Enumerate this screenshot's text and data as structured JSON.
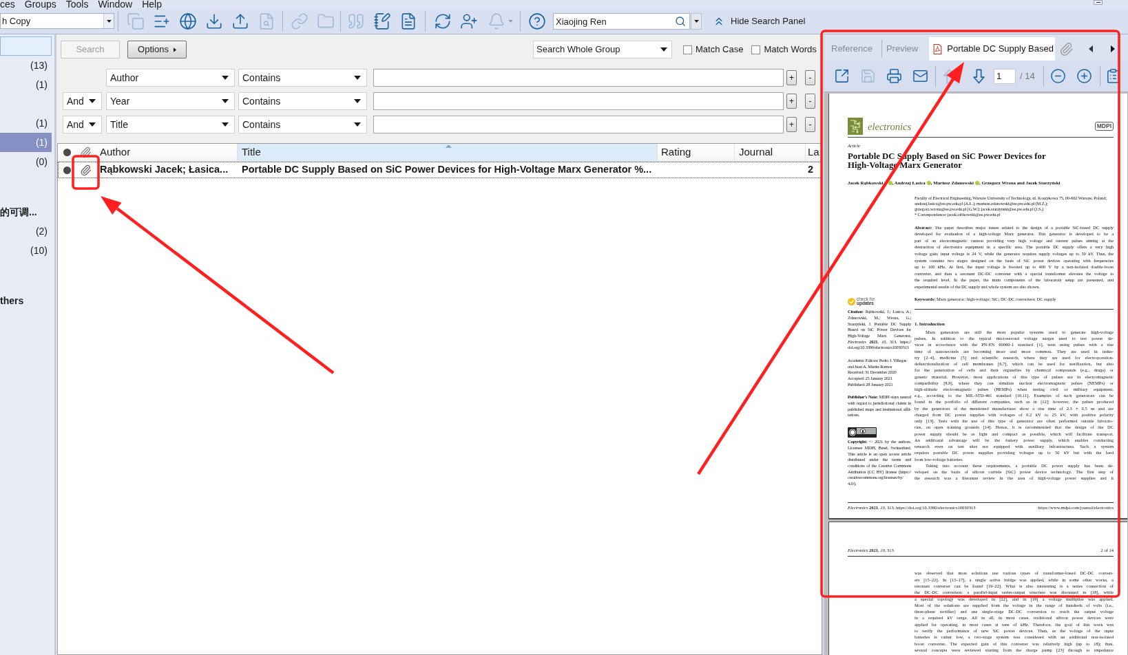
{
  "menu": [
    {
      "label": "ces"
    },
    {
      "label": "Groups"
    },
    {
      "label": "Tools"
    },
    {
      "label": "Window"
    },
    {
      "label": "Help"
    }
  ],
  "toolbar": {
    "style_dropdown": "h Copy",
    "groups": [
      [
        {
          "kind": "copy",
          "disabled": true
        },
        {
          "kind": "new-reference",
          "disabled": false
        },
        {
          "kind": "online-search",
          "disabled": false
        },
        {
          "kind": "import",
          "disabled": false
        },
        {
          "kind": "export",
          "disabled": false
        },
        {
          "kind": "find-pdf",
          "disabled": true
        }
      ],
      [
        {
          "kind": "link",
          "disabled": true
        },
        {
          "kind": "folder",
          "disabled": true
        }
      ],
      [
        {
          "kind": "citation",
          "disabled": true
        },
        {
          "kind": "edit",
          "disabled": false
        },
        {
          "kind": "word",
          "disabled": false
        }
      ],
      [
        {
          "kind": "sync",
          "disabled": false
        },
        {
          "kind": "share",
          "disabled": false
        },
        {
          "kind": "notify",
          "disabled": true
        }
      ],
      [
        {
          "kind": "help",
          "disabled": false
        }
      ]
    ],
    "search": {
      "value": "Xiaojing Ren"
    },
    "hide_panel": "Hide Search Panel"
  },
  "sidebar": {
    "items": [
      {
        "kind": "group",
        "focused": true,
        "selected": false
      },
      {
        "kind": "group",
        "count": "(13)",
        "focused": false,
        "selected": false
      },
      {
        "kind": "group",
        "count": "(1)",
        "focused": false,
        "selected": false
      },
      {
        "kind": "group",
        "focused": false,
        "selected": false
      },
      {
        "kind": "group",
        "count": "(1)",
        "focused": false,
        "selected": false
      },
      {
        "kind": "group",
        "count": "(1)",
        "focused": false,
        "selected": true
      },
      {
        "kind": "group",
        "count": "(0)",
        "focused": false,
        "selected": false
      },
      {
        "kind": "set",
        "label": "的可调..."
      },
      {
        "kind": "group",
        "count": "(2)",
        "focused": false,
        "selected": false
      },
      {
        "kind": "group",
        "count": "(10)",
        "focused": false,
        "selected": false
      },
      {
        "kind": "set",
        "label": "thers"
      }
    ]
  },
  "search_panel": {
    "search_button": {
      "label": "Search",
      "disabled": true
    },
    "options_button": {
      "label": "Options"
    },
    "scope": {
      "value": "Search Whole Group"
    },
    "checkboxes": [
      {
        "label": "Match Case",
        "checked": false
      },
      {
        "label": "Match Words",
        "checked": false
      }
    ],
    "rows": [
      {
        "field": "Author",
        "operator": "Contains",
        "add": "+",
        "remove": "-"
      },
      {
        "connector": "And",
        "field": "Year",
        "operator": "Contains",
        "add": "+",
        "remove": "-"
      },
      {
        "connector": "And",
        "field": "Title",
        "operator": "Contains",
        "add": "+",
        "remove": "-"
      }
    ]
  },
  "references": {
    "columns": [
      {
        "label": "Author",
        "sorted": false
      },
      {
        "label": "Title",
        "sorted": true
      },
      {
        "label": "Rating",
        "sorted": false
      },
      {
        "label": "Journal",
        "sorted": false
      },
      {
        "label": "La",
        "sorted": false
      }
    ],
    "rows": [
      {
        "unread": true,
        "attachment": true,
        "focused": true,
        "author": "Rąbkowski Jacek; Łasica...",
        "title": "Portable DC Supply Based on SiC Power Devices for High-Voltage Marx Generator %...",
        "column_5": "2"
      }
    ]
  },
  "pdf_viewer": {
    "tabs": [
      {
        "label": "Reference",
        "kind": "text",
        "selected": false
      },
      {
        "label": "Preview",
        "kind": "text",
        "selected": false
      },
      {
        "label": "Portable DC Supply Based",
        "kind": "file",
        "selected": true
      }
    ],
    "file_buttons": [
      {
        "kind": "open",
        "disabled": false
      },
      {
        "kind": "save",
        "disabled": true
      },
      {
        "kind": "print",
        "disabled": false
      },
      {
        "kind": "email",
        "disabled": false
      }
    ],
    "nav_buttons": [
      {
        "kind": "up",
        "disabled": true
      },
      {
        "kind": "down",
        "disabled": false
      }
    ],
    "page": "1",
    "total": "/ 14",
    "zoom_buttons": [
      {
        "kind": "zoom-out",
        "disabled": false
      },
      {
        "kind": "zoom-in",
        "disabled": false
      }
    ],
    "extra_buttons": [
      {
        "kind": "clipboard",
        "disabled": false
      }
    ],
    "pages": [
      {
        "kind": "first",
        "journal": "electronics",
        "publisher": "MDPI",
        "article_type": "Article",
        "title_lines": [
          "Portable DC Supply Based on SiC Power Devices for",
          "High-Voltage Marx Generator"
        ],
        "authors": [
          {
            "text": "Jacek Rąbkowski *",
            "id_icon": true
          },
          {
            "text": ", Andrzej Łasica",
            "id_icon": true
          },
          {
            "text": ", Mariusz Zdanowski",
            "id_icon": true
          },
          {
            "text": ", Grzegorz Wrona and Jacek Starzyński",
            "id_icon": false
          }
        ],
        "affiliation": [
          "Faculty of Electrical Engineering, Warsaw University of Technology, ul. Koszykowa 75, 00-662 Warsaw, Poland;",
          "andrzej.lasica@ee.pw.edu.pl (A.Ł.); mariusz.zdanowski@ee.pw.edu.pl (M.Z.);",
          "grzegorz.wrona@ee.pw.edu.pl (G.W.); jacek.starzynski@ee.pw.edu.pl (J.S.)",
          "* Correspondence: jacek.rabkowski@ee.pw.edu.pl"
        ],
        "abstract": [
          "**Abstract:** The paper describes major issues related to the design of a portable SiC-based DC supply",
          "developed for evaluation of a high-voltage Marx generator. This generator is developed to be a",
          "part of an electromagnetic cannon providing very high voltage and current pulses aiming at the",
          "destruction of electronics equipment in a specific area. The portable DC supply offers a very high",
          "voltage gain: input voltage is 24 V, while the generator requires supply voltages up to 50 kV. Thus, the",
          "system contains two stages designed on the basis of SiC power devices operating with frequencies",
          "up to 100 kHz. At first, the input voltage is boosted up to 400 V by a non-isolated double-boost",
          "converter, and then a resonant DC-DC converter with a special transformer elevates the voltage to",
          "the required level. In the paper, the main components of the laboratory setup are presented, and",
          "experimental results of the DC supply and whole system are also shown."
        ],
        "keywords": "**Keywords:** Marx generator; high-voltage; SiC; DC-DC converters; DC supply",
        "badge_lines": [
          "check for",
          "updates"
        ],
        "side_notes": [
          {
            "kind": "note",
            "lines": [
              "**Citation:** Rąbkowski, J.; Łasica, A.;",
              "Zdanowski, M.; Wrona, G.;",
              "Starzyński, J. Portable DC Supply",
              "Based on SiC Power Devices for",
              "High-Voltage Marx Generator.",
              "*Electronics* **2021**, *10*, 313. https://",
              "doi.org/10.3390/electronics10030313"
            ]
          },
          {
            "kind": "dates",
            "lines": [
              "Academic Editors: Pedro J. Villegas",
              "and Juan A. Martín-Ramos",
              "Received: 31 December 2020",
              "Accepted: 25 January 2021",
              "Published: 28 January 2021"
            ]
          },
          {
            "kind": "note",
            "lines": [
              "**Publisher's Note:** MDPI stays neutral",
              "with regard to jurisdictional claims in",
              "published maps and institutional affil-",
              "iations."
            ]
          },
          {
            "kind": "license",
            "lines": [
              "**Copyright:** © 2021 by the authors.",
              "Licensee MDPI, Basel, Switzerland.",
              "This article is an open access article",
              "distributed under the terms and",
              "conditions of the Creative Commons",
              "Attribution (CC BY) license (https://",
              "creativecommons.org/licenses/by/",
              "4.0/)."
            ]
          }
        ],
        "heading": "1. Introduction",
        "paragraphs": [
          [
            "Marx generators are still the most popular systems used to generate high-voltage",
            "pulses. In addition to the typical microsecond voltage surges used to test power de-",
            "vices in accordance with the PN-EN 60060-1 standard [1], tests using pulses with a rise",
            "time of nanoseconds are becoming more and more common. They are used in indus-",
            "try [2–4], medicine [5] and scientific research, where they are used for electroporation-",
            "defunctionalization of cell membranes [6,7], which can be used for sterilization, but also",
            "for the penetration of cells and their organelles by chemical compounds (e.g., drugs) or",
            "genetic material. However, most applications of this type of pulses are in electromagnetic",
            "compatibility [8,9], where they can simulate nuclear electromagnetic pulses (NEMPs) or",
            "high-altitude electromagnetic pulses (HEMPs) when testing civil or military equipment,",
            "e.g., according to the MIL-STD-461 standard [10,11]. Examples of such generators can be",
            "found in the portfolio of different companies, such as in [12]; however, the pulses produced",
            "by the generators of the mentioned manufacturer show a rise time of 2.3 ± 0.5 ns and are",
            "charged from DC power supplies with voltages of 0.2 kV to 25 kV, with positive polarity",
            "only [13]. Tests with the use of this type of generator are often performed outside laborato-",
            "ries, on open training grounds [14]. Hence, it is recommended that the design of the DC",
            "power supply should be as light and compact as possible, which will facilitate transport.",
            "An additional advantage will be the battery power supply, which enables conducting",
            "research even on test sites not equipped with auxiliary infrastructure. Such a system",
            "requires portable DC power supplies providing voltages up to 50 kV but with the feed",
            "from low-voltage batteries."
          ],
          [
            "Taking into account these requirements, a portable DC power supply has been de-",
            "veloped on the basis of silicon carbide (SiC) power device technology. The first step of",
            "the research was a literature review in the area of high-voltage power supplies and it"
          ]
        ],
        "footer_left": "*Electronics* **2021**, *10*, 313. https://doi.org/10.3390/electronics10030313",
        "footer_right": "https://www.mdpi.com/journal/electronics"
      },
      {
        "kind": "continued",
        "header_left": "*Electronics* **2021**, *10*, 313",
        "header_right": "2 of 14",
        "paragraphs": [
          [
            "was observed that most solutions use various types of transformer-based DC-DC convert-",
            "ers [15–22]. In [15–17], a single active bridge was applied, while in some other works, a",
            "resonant converter can be found [19–22]. What is also interesting is a series connection of",
            "the DC-DC converters: a parallel-input series-output structure was discussed in [18], while",
            "a special topology was developed in [22], and in [19] a voltage multiplier was applied.",
            "Most of the solutions are supplied from the voltage in the range of hundreds of volts (i.e.,",
            "three-phase rectifier) and use single-stage DC-DC conversion to reach the output voltage",
            "in a required kV range. All in all, in most cases, traditional silicon power devices were",
            "applied for operating, in most cases at tens of kHz. Therefore, the goal of this work was",
            "to verify the performance of new SiC power devices. Then, as the voltage of the input",
            "batteries is rather low, a two-stage system was considered with an additional non-isolated",
            "boost converter. The expected gain of this converter was relatively high (up to 18); thus,",
            "several concepts were reviewed starting from the charge pump [23] through to impedance"
          ]
        ]
      }
    ]
  }
}
